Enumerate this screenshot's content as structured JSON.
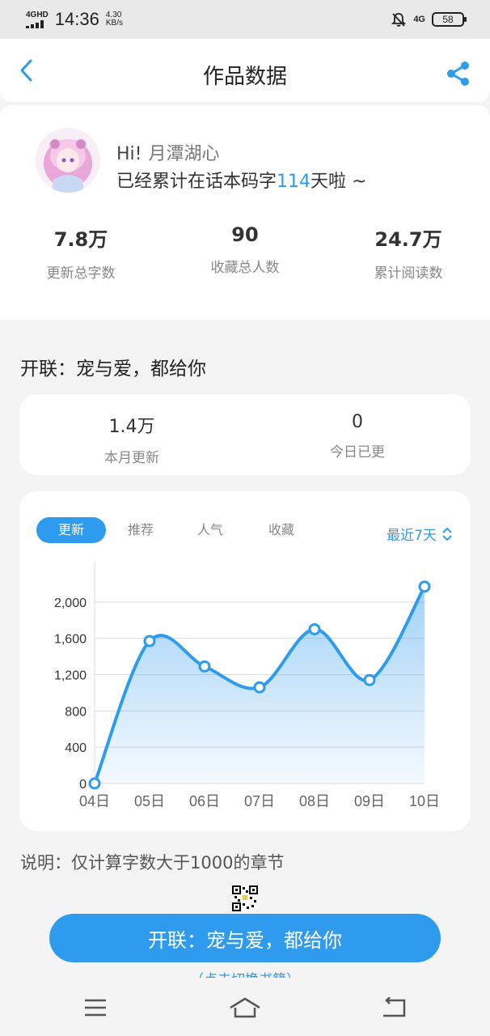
{
  "status_bar": {
    "network": "4GHD",
    "time": "14:36",
    "speed_value": "4.30",
    "speed_unit": "KB/s",
    "network_right": "4G",
    "battery": "58"
  },
  "header": {
    "title": "作品数据",
    "back_icon": "chevron-left-icon",
    "share_icon": "share-icon"
  },
  "profile": {
    "greeting": "Hi!",
    "username": "月潭湖心",
    "days_prefix": "已经累计在话本码字",
    "days": "114",
    "days_suffix": "天啦 ~",
    "stats": [
      {
        "value": "7.8万",
        "label": "更新总字数"
      },
      {
        "value": "90",
        "label": "收藏总人数"
      },
      {
        "value": "24.7万",
        "label": "累计阅读数"
      }
    ]
  },
  "work": {
    "title": "开联：宠与爱，都给你",
    "month_stats": [
      {
        "value": "1.4万",
        "label": "本月更新"
      },
      {
        "value": "0",
        "label": "今日已更"
      }
    ]
  },
  "chart_card": {
    "tabs": [
      "更新",
      "推荐",
      "人气",
      "收藏"
    ],
    "active_tab": 0,
    "range_label": "最近7天",
    "range_icon": "chevron-up-down-icon"
  },
  "chart_data": {
    "type": "area",
    "x": [
      "04日",
      "05日",
      "06日",
      "07日",
      "08日",
      "09日",
      "10日"
    ],
    "series": [
      {
        "values": [
          0,
          1570,
          1290,
          1060,
          1700,
          1140,
          2170
        ]
      }
    ],
    "y_ticks": [
      "0",
      "400",
      "800",
      "1,200",
      "1,600",
      "2,000"
    ],
    "ylim": [
      0,
      2400
    ],
    "grid": true,
    "color": "#2f9bee"
  },
  "note": "说明：仅计算字数大于1000的章节",
  "main_button": "开联：宠与爱，都给你",
  "peek_text": "（点击切换书籍）",
  "nav": {
    "menu_icon": "menu-icon",
    "home_icon": "home-icon",
    "back_icon": "back-icon"
  }
}
